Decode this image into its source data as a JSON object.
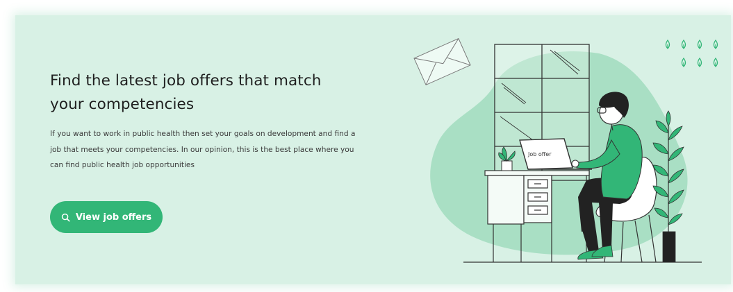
{
  "banner": {
    "headline_line1": "Find the latest job offers that match",
    "headline_line2": "your competencies",
    "description_line1": "If you want to work in public health then set your goals on development and find a",
    "description_line2": "job that meets your competencies. In our opinion, this is the best place where you",
    "description_line3": "can find public health job opportunities",
    "cta_label": "View job offers",
    "cta_icon": "search-icon"
  },
  "illustration": {
    "laptop_screen_text": "Job offer"
  },
  "colors": {
    "banner_background": "#d8f1e5",
    "accent": "#32b677",
    "blob": "#a9dfc4",
    "text": "#1f1f1f"
  }
}
